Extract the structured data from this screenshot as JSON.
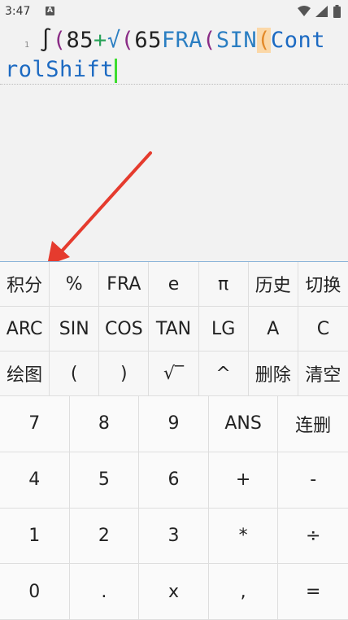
{
  "status_bar": {
    "time": "3:47",
    "notification_icon": "A"
  },
  "editor": {
    "line_number": "1",
    "line1": {
      "t1": "∫",
      "t2": "(",
      "t3": "85",
      "t4": "+",
      "t5": "√",
      "t6": "(",
      "t7": "65",
      "t8": "FRA",
      "t9": "(",
      "t10": "SIN",
      "t11": "(",
      "t12": "Cont"
    },
    "line2": "rolShift"
  },
  "function_keys": [
    [
      "积分",
      "%",
      "FRA",
      "e",
      "π",
      "历史",
      "切换"
    ],
    [
      "ARC",
      "SIN",
      "COS",
      "TAN",
      "LG",
      "A",
      "C"
    ],
    [
      "绘图",
      "(",
      ")",
      "√‾",
      "^",
      "删除",
      "清空"
    ]
  ],
  "number_keys": [
    [
      "7",
      "8",
      "9",
      "ANS",
      "连删"
    ],
    [
      "4",
      "5",
      "6",
      "+",
      "-"
    ],
    [
      "1",
      "2",
      "3",
      "*",
      "÷"
    ],
    [
      "0",
      ".",
      "x",
      ",",
      "="
    ]
  ],
  "colors": {
    "cursor": "#3ddc2f",
    "arrow": "#e53b2e",
    "highlight_paren": "#fbd8a8"
  },
  "icons": [
    "wifi-icon",
    "signal-icon",
    "battery-icon",
    "arrow-annotation"
  ]
}
